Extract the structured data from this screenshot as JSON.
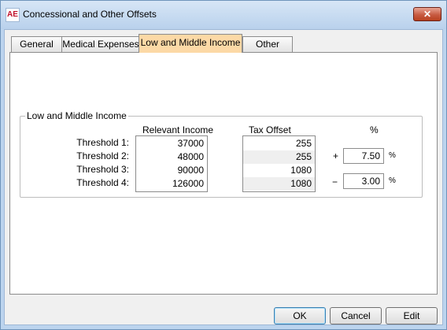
{
  "window": {
    "app_icon": "AE",
    "title": "Concessional and Other Offsets",
    "close_label": "✕"
  },
  "tabs": [
    {
      "label": "General",
      "active": false
    },
    {
      "label": "Medical Expenses",
      "active": false
    },
    {
      "label": "Low and Middle Income",
      "active": true
    },
    {
      "label": "Other",
      "active": false
    }
  ],
  "group": {
    "label": "Low and Middle Income",
    "col_relevant_income": "Relevant Income",
    "col_tax_offset": "Tax Offset",
    "col_percent": "%",
    "rows": [
      {
        "label": "Threshold 1:",
        "income": "37000",
        "offset": "255"
      },
      {
        "label": "Threshold 2:",
        "income": "48000",
        "offset": "255"
      },
      {
        "label": "Threshold 3:",
        "income": "90000",
        "offset": "1080"
      },
      {
        "label": "Threshold 4:",
        "income": "126000",
        "offset": "1080"
      }
    ],
    "plus_sign": "+",
    "minus_sign": "−",
    "plus_rate": "7.50",
    "minus_rate": "3.00",
    "pct_suffix": "%"
  },
  "buttons": {
    "ok": "OK",
    "cancel": "Cancel",
    "edit": "Edit"
  }
}
